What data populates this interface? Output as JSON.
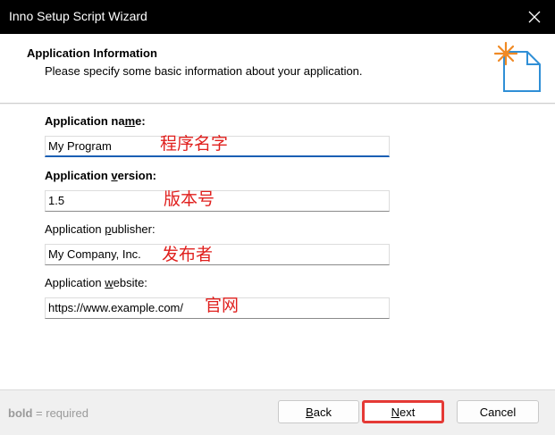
{
  "window": {
    "title": "Inno Setup Script Wizard"
  },
  "header": {
    "title": "Application Information",
    "subtitle": "Please specify some basic information about your application."
  },
  "fields": {
    "name": {
      "label_pre": "Application na",
      "label_key": "m",
      "label_post": "e:",
      "value": "My Program",
      "annotation": "程序名字"
    },
    "version": {
      "label_pre": "Application ",
      "label_key": "v",
      "label_post": "ersion:",
      "value": "1.5",
      "annotation": "版本号"
    },
    "publisher": {
      "label_pre": "Application ",
      "label_key": "p",
      "label_post": "ublisher:",
      "value": "My Company, Inc.",
      "annotation": "发布者"
    },
    "website": {
      "label_pre": "Application ",
      "label_key": "w",
      "label_post": "ebsite:",
      "value": "https://www.example.com/",
      "annotation": "官网"
    }
  },
  "footer": {
    "hint_bold": "bold",
    "hint_rest": " = required",
    "back_key": "B",
    "back_rest": "ack",
    "next_key": "N",
    "next_rest": "ext",
    "cancel_label": "Cancel"
  },
  "colors": {
    "annotation": "#e0201e",
    "highlight_box": "#e53935",
    "focus_underline": "#1a5fb4"
  },
  "icons": {
    "close": "close-icon",
    "wizard": "wizard-document-icon"
  }
}
